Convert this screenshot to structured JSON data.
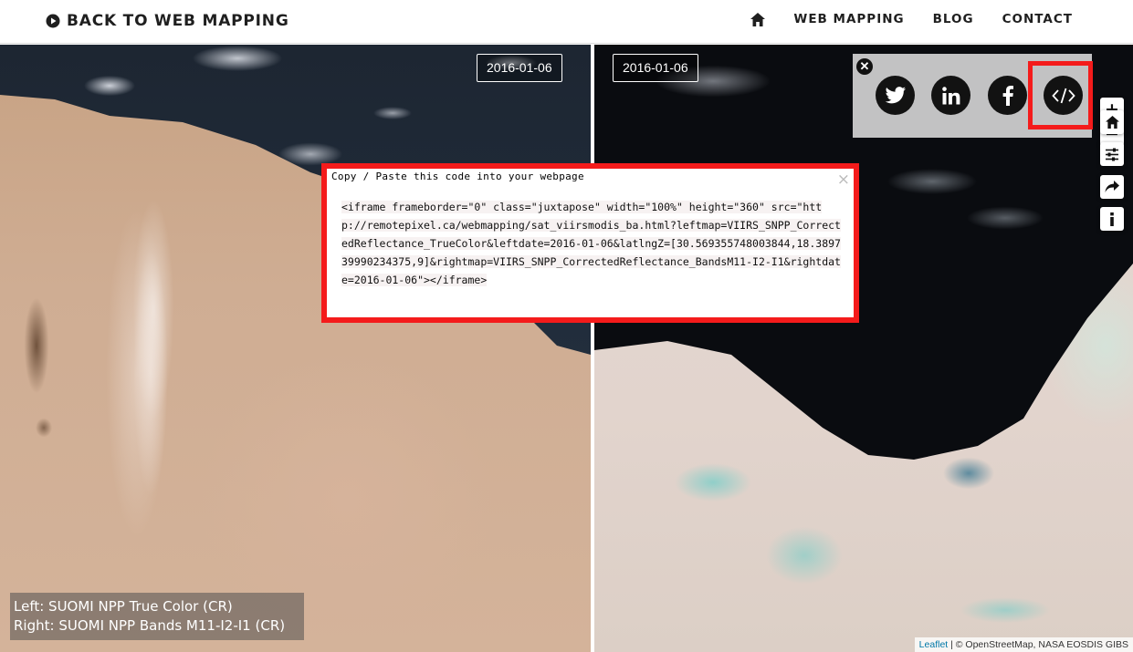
{
  "header": {
    "back_label": "BACK TO WEB MAPPING",
    "nav": [
      {
        "label": "WEB MAPPING"
      },
      {
        "label": "BLOG"
      },
      {
        "label": "CONTACT"
      }
    ]
  },
  "map": {
    "left_date": "2016-01-06",
    "right_date": "2016-01-06",
    "legend_left": "Left: SUOMI NPP True Color (CR)",
    "legend_right": "Right: SUOMI NPP Bands M11-I2-I1 (CR)",
    "attribution_leaflet": "Leaflet",
    "attribution_rest": " | © OpenStreetMap, NASA EOSDIS GIBS"
  },
  "share": {
    "icons": [
      "twitter-icon",
      "linkedin-icon",
      "facebook-icon",
      "embed-code-icon"
    ]
  },
  "controls": {
    "zoom_in": "+",
    "zoom_out": "−",
    "icons": [
      "home-icon",
      "sliders-icon",
      "share-arrow-icon",
      "info-icon"
    ]
  },
  "embed_popup": {
    "title": "Copy / Paste this code into your webpage",
    "close": "×",
    "code": "<iframe frameborder=\"0\" class=\"juxtapose\" width=\"100%\" height=\"360\" src=\"http://remotepixel.ca/webmapping/sat_viirsmodis_ba.html?leftmap=VIIRS_SNPP_CorrectedReflectance_TrueColor&leftdate=2016-01-06&latlngZ=[30.569355748003844,18.389739990234375,9]&rightmap=VIIRS_SNPP_CorrectedReflectance_BandsM11-I2-I1&rightdate=2016-01-06\"></iframe>"
  },
  "colors": {
    "highlight": "#f41b1b",
    "share_button": "#121212"
  }
}
